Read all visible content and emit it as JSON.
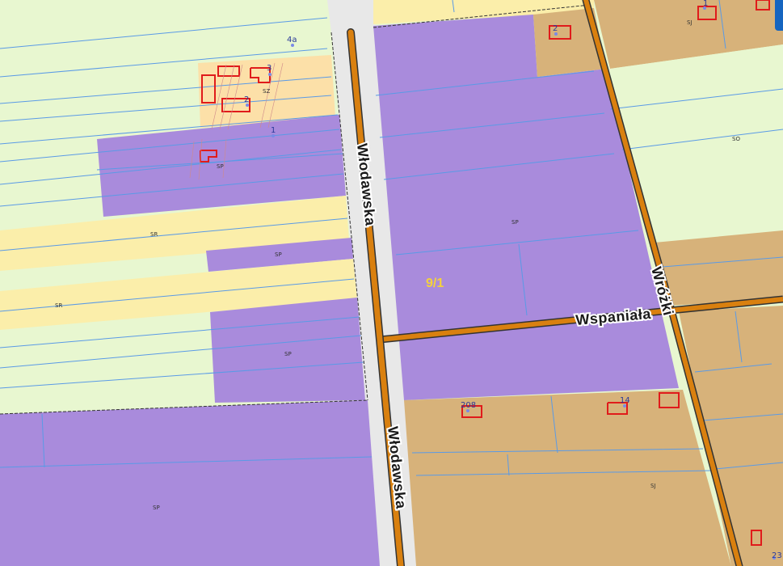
{
  "map": {
    "streets": [
      {
        "id": "wlodawska-upper",
        "label": "Włodawska"
      },
      {
        "id": "wlodawska-lower",
        "label": "Włodawska"
      },
      {
        "id": "wspaniala",
        "label": "Wspaniała"
      },
      {
        "id": "wrozki",
        "label": "Wróżki"
      }
    ],
    "parcel_label": "9/1",
    "zone_labels": [
      "SP",
      "SP",
      "SP",
      "SP",
      "SP",
      "SP",
      "SR",
      "SR",
      "SZ",
      "SJ",
      "SJ",
      "SO"
    ],
    "address_numbers": [
      "4a",
      "3",
      "2",
      "1",
      "2",
      "1",
      "208",
      "14",
      "23"
    ],
    "colors": {
      "agricultural": "#e8f7d0",
      "sp_purple": "#a98bdc",
      "sr_yellow": "#fbeeaa",
      "sj_brown": "#d7b27a",
      "sz_beige": "#fce0a8",
      "road_orange": "#d9800f",
      "road_grey": "#e8e8e8",
      "parcel_line": "#5a9ae6",
      "building_outline": "#e01b1b",
      "parcel_label_yellow": "#f4d23c",
      "corner_button": "#1565c0"
    }
  }
}
